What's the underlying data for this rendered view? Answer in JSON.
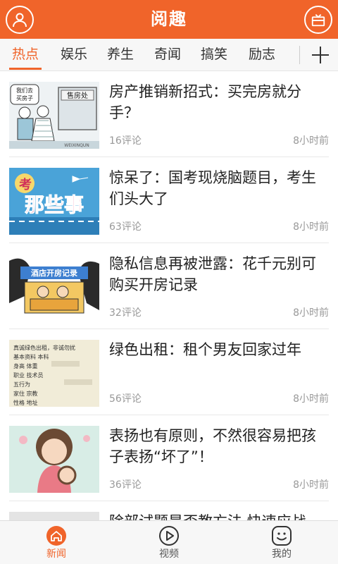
{
  "header": {
    "title": "阅趣",
    "left_icon": "user-avatar-icon",
    "right_icon": "gift-icon",
    "accent": "#f0642a"
  },
  "tabs": [
    {
      "label": "热点",
      "active": true
    },
    {
      "label": "娱乐",
      "active": false
    },
    {
      "label": "养生",
      "active": false
    },
    {
      "label": "奇闻",
      "active": false
    },
    {
      "label": "搞笑",
      "active": false
    },
    {
      "label": "励志",
      "active": false
    }
  ],
  "tabs_more_icon": "plus-icon",
  "articles": [
    {
      "title": "房产推销新招式：买完房就分手？",
      "comments": "16评论",
      "time": "8小时前",
      "thumb": {
        "speech": "我们去\n买房子",
        "sign": "售房处",
        "caption": "WEIXINQUN"
      }
    },
    {
      "title": "惊呆了：国考现烧脑题目，考生们头大了",
      "comments": "63评论",
      "time": "8小时前",
      "thumb": {
        "tag": "考",
        "main": "那些事"
      }
    },
    {
      "title": "隐私信息再被泄露：花千元别可购买开房记录",
      "comments": "32评论",
      "time": "8小时前",
      "thumb": {
        "sign": "酒店开房记录"
      }
    },
    {
      "title": "绿色出租：租个男友回家过年",
      "comments": "56评论",
      "time": "8小时前",
      "thumb": {
        "lines": [
          "真诚绿色出租，非诚勿扰",
          "基本资料 本科",
          "身高 体重",
          "职业 技术员",
          "五行为 ",
          "家住 宗教 ",
          "性格 地址"
        ]
      }
    },
    {
      "title": "表扬也有原则，不然很容易把孩子表扬“坏了”！",
      "comments": "36评论",
      "time": "8小时前",
      "thumb": {}
    },
    {
      "title": "除部试题是否教方法 快速应战",
      "comments": "",
      "time": "",
      "thumb": {}
    }
  ],
  "bottom_nav": [
    {
      "label": "新闻",
      "icon": "home-icon",
      "active": true
    },
    {
      "label": "视频",
      "icon": "play-icon",
      "active": false
    },
    {
      "label": "我的",
      "icon": "smiley-icon",
      "active": false
    }
  ]
}
